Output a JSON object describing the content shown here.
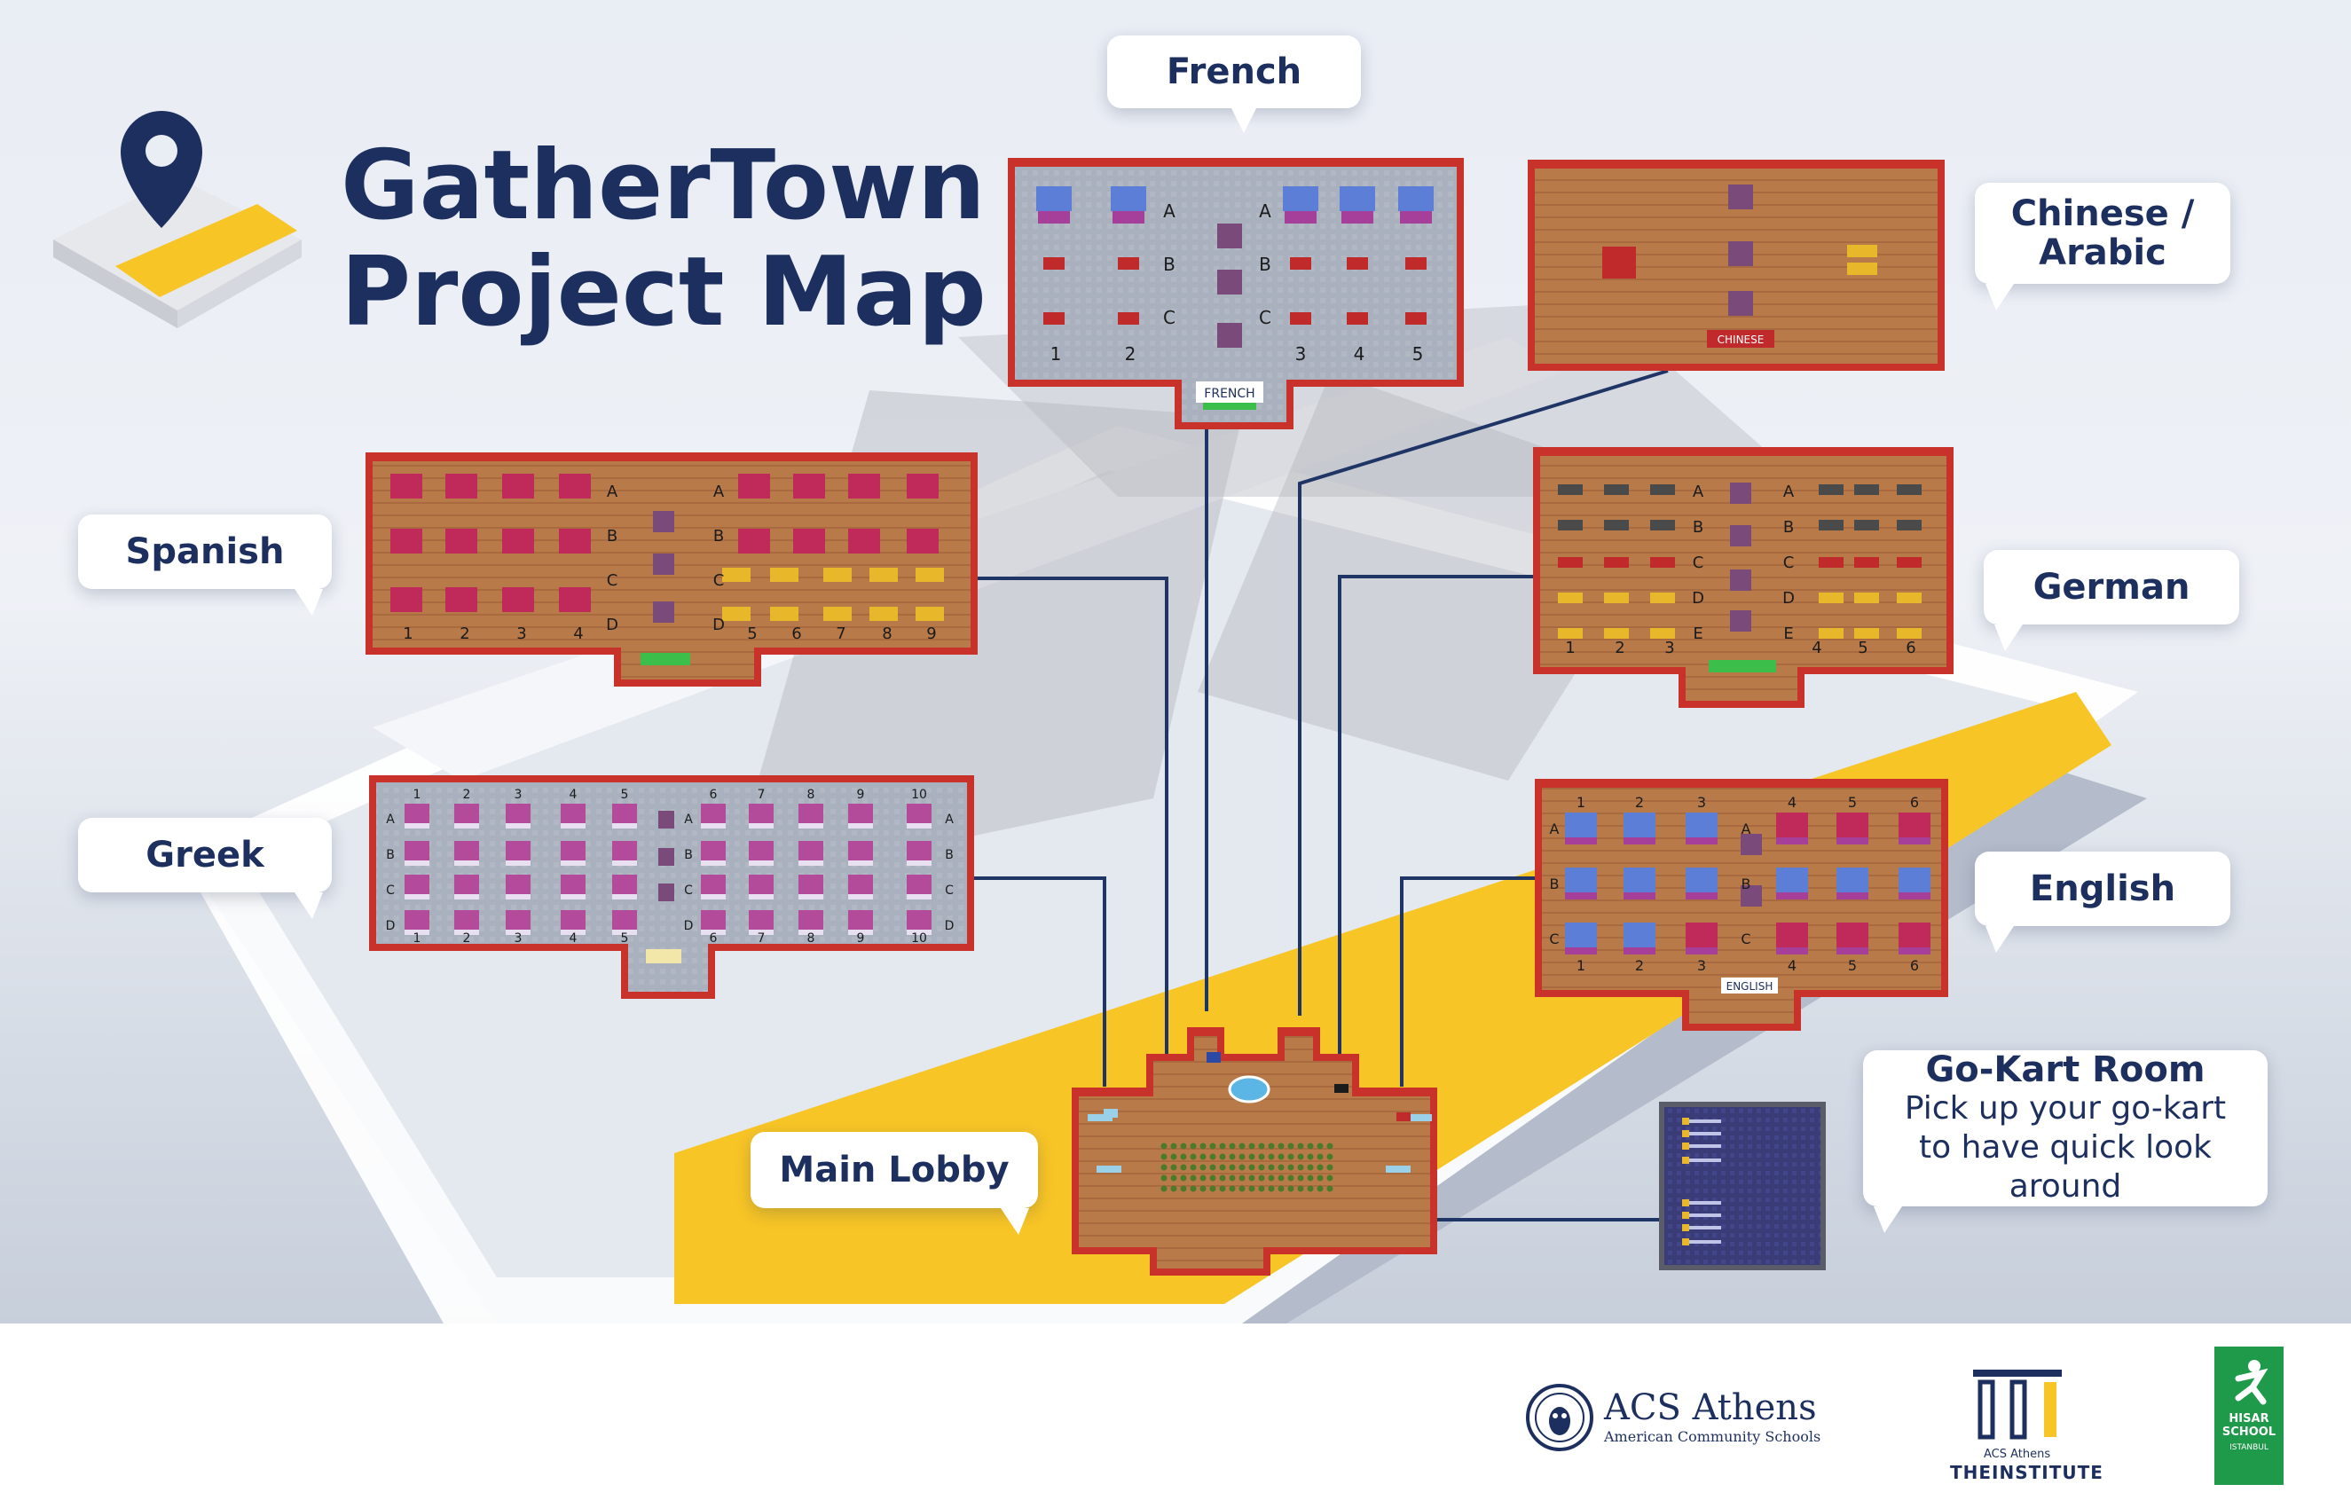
{
  "title": {
    "line1": "GatherTown",
    "line2": "Project Map"
  },
  "rooms": {
    "french": {
      "label": "French",
      "sign": "FRENCH",
      "rows": [
        "A",
        "B",
        "C"
      ],
      "cols": [
        "1",
        "2",
        "3",
        "4",
        "5"
      ]
    },
    "chinese_arabic": {
      "label_line1": "Chinese /",
      "label_line2": "Arabic",
      "sign": "CHINESE"
    },
    "spanish": {
      "label": "Spanish",
      "rows": [
        "A",
        "B",
        "C",
        "D"
      ],
      "cols": [
        "1",
        "2",
        "3",
        "4",
        "5",
        "6",
        "7",
        "8",
        "9"
      ]
    },
    "german": {
      "label": "German",
      "rows": [
        "A",
        "B",
        "C",
        "D",
        "E"
      ],
      "cols": [
        "1",
        "2",
        "3",
        "4",
        "5",
        "6"
      ]
    },
    "greek": {
      "label": "Greek",
      "rows": [
        "A",
        "B",
        "C",
        "D"
      ],
      "cols": [
        "1",
        "2",
        "3",
        "4",
        "5",
        "6",
        "7",
        "8",
        "9",
        "10"
      ]
    },
    "english": {
      "label": "English",
      "sign": "ENGLISH",
      "rows": [
        "A",
        "B",
        "C"
      ],
      "cols": [
        "1",
        "2",
        "3",
        "4",
        "5",
        "6"
      ]
    },
    "main_lobby": {
      "label": "Main Lobby"
    },
    "go_kart": {
      "label": "Go-Kart Room",
      "desc_line1": "Pick up your go-kart",
      "desc_line2": "to have quick look around"
    }
  },
  "footer": {
    "acs_name": "ACS Athens",
    "acs_sub": "American Community Schools",
    "institute_small": "ACS Athens",
    "institute_name": "THEINSTITUTE",
    "hisar_line1": "HISAR",
    "hisar_line2": "SCHOOL",
    "hisar_line3": "ISTANBUL"
  },
  "colors": {
    "navy": "#1c2f5e",
    "yellow": "#f7c526",
    "wall_red": "#c8322a",
    "wood": "#b97a4a",
    "grey_floor": "#a7afbd",
    "connector": "#1f3566"
  }
}
